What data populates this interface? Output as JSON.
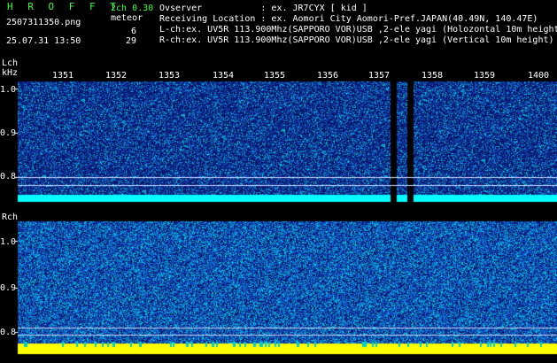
{
  "app": {
    "title": "H R O F F T",
    "version": "2ch 0.30",
    "meteor_label": "meteor",
    "l_count": "6",
    "r_count": "29",
    "filename": "2507311350.png",
    "datetime": "25.07.31 13:50"
  },
  "info": {
    "observer": "Ovserver           : ex. JR7CYX [ kid ]",
    "location": "Receiving Location : ex. Aomori City Aomori-Pref.JAPAN(40.49N, 140.47E)",
    "lch": "L-ch:ex. UV5R 113.900Mhz(SAPPORO VOR)USB ,2-ele yagi (Holozontal 10m height)",
    "rch": "R-ch:ex. UV5R 113.900Mhz(SAPPORO VOR)USB ,2-ele yagi (Vertical 10m height)"
  },
  "lch_panel": {
    "label": "Lch",
    "unit": "kHz",
    "yticks": [
      "1.0",
      "0.9",
      "0.8"
    ],
    "times": [
      "1351",
      "1352",
      "1353",
      "1354",
      "1355",
      "1356",
      "1357",
      "1358",
      "1359",
      "1400"
    ]
  },
  "rch_panel": {
    "label": "Rch",
    "yticks": [
      "1.0",
      "0.9",
      "0.8"
    ]
  },
  "colors": {
    "accent_green": "#3cff3c",
    "signal_cyan": "#00ffff",
    "signal_yellow": "#ffff00",
    "background_blue": "#102070"
  }
}
